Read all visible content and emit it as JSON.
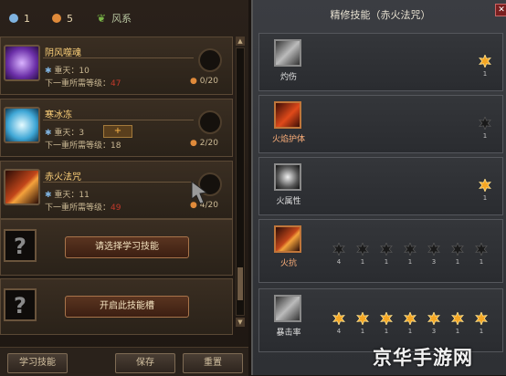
{
  "topbar": {
    "gem1_count": "1",
    "gem2_count": "5",
    "element": "风系"
  },
  "skills": [
    {
      "name": "阴风噬魂",
      "rank": "重天：10",
      "req_label": "下一重所需等级：",
      "req_value": "47",
      "points": "0/20"
    },
    {
      "name": "寒冰冻",
      "rank": "重天：3",
      "req_label": "下一重所需等级：",
      "req_value": "18",
      "points": "2/20",
      "plus": "+"
    },
    {
      "name": "赤火法咒",
      "rank": "重天：11",
      "req_label": "下一重所需等级：",
      "req_value": "49",
      "points": "4/20"
    }
  ],
  "locked": [
    {
      "button": "请选择学习技能"
    },
    {
      "button": "开启此技能槽"
    }
  ],
  "bottom_buttons": {
    "learn": "学习技能",
    "save": "保存",
    "reset": "重置"
  },
  "panel": {
    "title": "精修技能（赤火法咒）",
    "rows": [
      {
        "name": "灼伤",
        "nodes": [
          {
            "label": "1",
            "active": true
          }
        ]
      },
      {
        "name": "火焰护体",
        "nodes": [
          {
            "label": "1",
            "active": false
          }
        ]
      },
      {
        "name": "火属性",
        "nodes": [
          {
            "label": "1",
            "active": true
          }
        ]
      },
      {
        "name": "火抗",
        "nodes": [
          {
            "label": "4",
            "active": false
          },
          {
            "label": "1",
            "active": false
          },
          {
            "label": "1",
            "active": false
          },
          {
            "label": "1",
            "active": false
          },
          {
            "label": "3",
            "active": false
          },
          {
            "label": "1",
            "active": false
          },
          {
            "label": "1",
            "active": false
          }
        ]
      },
      {
        "name": "暴击率",
        "nodes": [
          {
            "label": "4",
            "active": true
          },
          {
            "label": "1",
            "active": true
          },
          {
            "label": "1",
            "active": true
          },
          {
            "label": "1",
            "active": true
          },
          {
            "label": "3",
            "active": true
          },
          {
            "label": "1",
            "active": true
          },
          {
            "label": "1",
            "active": true
          }
        ]
      }
    ]
  },
  "colors": {
    "accent": "#ffd27a",
    "warning": "#c0392b",
    "active_node": "#f5a623",
    "inactive_node": "#1a1a1a"
  },
  "watermark": "京华手游网"
}
